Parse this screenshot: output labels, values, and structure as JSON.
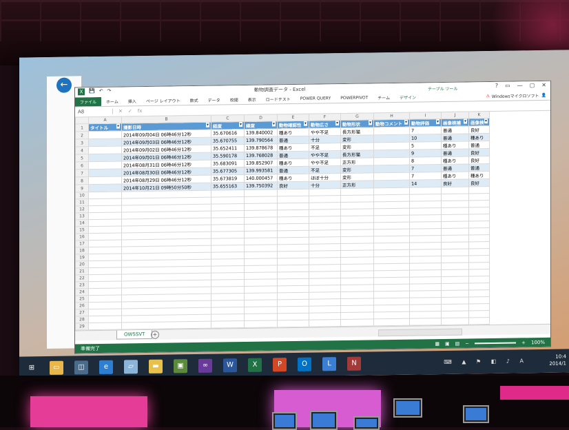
{
  "window": {
    "title": "動物調査データ - Excel",
    "controls": [
      "?",
      "▭",
      "—",
      "▢",
      "✕"
    ]
  },
  "ribbon": {
    "tabs": [
      "ファイル",
      "ホーム",
      "挿入",
      "ページ レイアウト",
      "数式",
      "データ",
      "校閲",
      "表示",
      "ロードテスト",
      "POWER QUERY",
      "POWERPIVOT",
      "チーム",
      "デザイン"
    ],
    "context_header": "テーブル ツール",
    "account": "Windowsマイクロソフト"
  },
  "formula_bar": {
    "name_box": "A8",
    "fx": "fx"
  },
  "columns": [
    "A",
    "B",
    "C",
    "D",
    "E",
    "F",
    "G",
    "H",
    "I",
    "J",
    "K"
  ],
  "table": {
    "headers": [
      "タイトル",
      "撮影日時",
      "経度",
      "緯度",
      "動物確認性",
      "動物広さ",
      "動物形状",
      "動物コメント",
      "動物評価",
      "画像検補",
      "画像検"
    ],
    "rows": [
      [
        "",
        "2014年09月04日 06時46分12秒",
        "35.670616",
        "139.840002",
        "種あり",
        "やや不足",
        "長方形猫",
        "",
        "7",
        "普通",
        "良好"
      ],
      [
        "",
        "2014年09月03日 06時46分12秒",
        "35.670755",
        "139.790564",
        "普通",
        "十分",
        "変形",
        "",
        "10",
        "普通",
        "種あり"
      ],
      [
        "",
        "2014年09月02日 06時46分12秒",
        "35.652411",
        "139.878678",
        "種あり",
        "不足",
        "変形",
        "",
        "5",
        "種あり",
        "普通"
      ],
      [
        "",
        "2014年09月01日 06時46分12秒",
        "35.590178",
        "139.768028",
        "普通",
        "やや不足",
        "長方形猫",
        "",
        "9",
        "普通",
        "良好"
      ],
      [
        "",
        "2014年08月31日 06時46分12秒",
        "35.683091",
        "139.852907",
        "種あり",
        "やや不足",
        "正方形",
        "",
        "8",
        "種あり",
        "良好"
      ],
      [
        "",
        "2014年08月30日 06時46分12秒",
        "35.677305",
        "139.993581",
        "普通",
        "不足",
        "変形",
        "",
        "7",
        "普通",
        "普通"
      ],
      [
        "",
        "2014年08月29日 06時46分12秒",
        "35.673819",
        "140.000457",
        "種あり",
        "ほぼ十分",
        "変形",
        "",
        "7",
        "種あり",
        "種あり"
      ],
      [
        "",
        "2014年10月21日 09時50分50秒",
        "35.655163",
        "139.750392",
        "良好",
        "十分",
        "正方形",
        "",
        "14",
        "良好",
        "良好"
      ]
    ],
    "row_numbers": [
      "1",
      "2",
      "3",
      "4",
      "5",
      "6",
      "7",
      "8",
      "9",
      "10",
      "11",
      "12",
      "13",
      "14",
      "15",
      "16",
      "17",
      "18",
      "19",
      "20",
      "21",
      "22",
      "23",
      "24",
      "25",
      "26",
      "27",
      "28",
      "29"
    ]
  },
  "sheet": {
    "tab": "OWSSVT",
    "add": "+"
  },
  "status": {
    "ready": "準備完了",
    "zoom": "100%"
  },
  "taskbar": {
    "clock_time": "10:4",
    "clock_date": "2014/1"
  }
}
